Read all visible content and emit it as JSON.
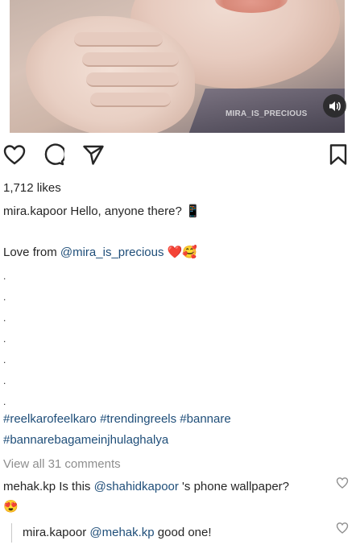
{
  "media": {
    "watermark": "MIRA_IS_PRECIOUS",
    "sound_icon": "speaker-icon"
  },
  "actions": {
    "like_icon": "heart-outline-icon",
    "comment_icon": "comment-bubble-icon",
    "share_icon": "paper-plane-icon",
    "save_icon": "bookmark-outline-icon"
  },
  "post": {
    "likes": "1,712 likes",
    "author": "mira.kapoor",
    "caption_line1": "Hello, anyone there? 📱",
    "love_prefix": "Love from ",
    "love_mention": "@mira_is_precious",
    "love_emoji": "❤️🥰",
    "dots": [
      ".",
      ".",
      ".",
      ".",
      ".",
      ".",
      "."
    ],
    "hashtags_line1": "#reelkarofeelkaro #trendingreels #bannare",
    "hashtags_line2": "#bannarebagameinjhulaghalya",
    "view_comments": "View all 31 comments"
  },
  "comments": [
    {
      "user": "mehak.kp",
      "text_before": "Is this ",
      "mention": "@shahidkapoor",
      "text_after": " 's phone wallpaper?",
      "line2": "😍"
    }
  ],
  "reply": {
    "user": "mira.kapoor",
    "mention": "@mehak.kp",
    "text": " good one!"
  },
  "colors": {
    "text": "#262626",
    "link": "#1f4e79",
    "muted": "#8e8e8e",
    "background": "#ffffff"
  }
}
